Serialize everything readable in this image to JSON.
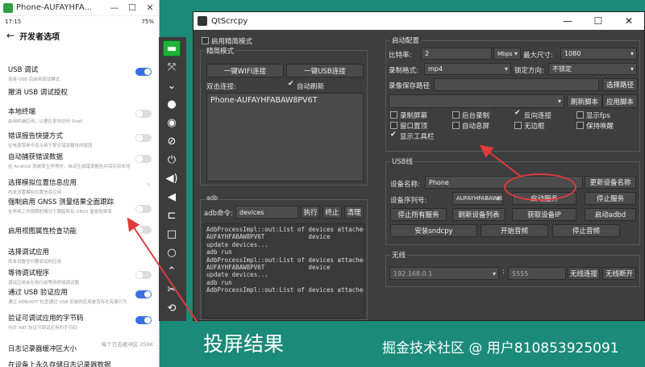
{
  "phone_window": {
    "title": "Phone-AUFAYHFA...",
    "status_time": "17:15",
    "status_right": "75%",
    "header": "开发者选项",
    "settings": [
      {
        "title": "USB 调试",
        "sub": "连接 USB 后启用调试模式",
        "control": "toggle-on"
      },
      {
        "title": "撤消 USB 调试授权",
        "sub": "",
        "control": "none"
      },
      {
        "title": "本地终端",
        "sub": "启用终端应用，以便在本地访问 Shell",
        "control": "toggle-off"
      },
      {
        "title": "错误报告快捷方式",
        "sub": "在电源菜单中显示用于提交错误报告的按钮",
        "control": "toggle-off"
      },
      {
        "title": "自动捕获错误数据",
        "sub": "在 Android 系统发生异常时，自动生成错误报告并保存到本地",
        "control": "toggle-off"
      },
      {
        "title": "选择模拟位置信息应用",
        "sub": "尚未设置模拟位置信息应用",
        "control": "chevron"
      },
      {
        "title": "强制启用 GNSS 测量结果全面跟踪",
        "sub": "在停用工作周期的情况下跟踪所有 GNSS 星座和频率",
        "control": "toggle-off"
      },
      {
        "title": "启用视图属性检查功能",
        "sub": "",
        "control": "toggle-off"
      },
      {
        "title": "选择调试应用",
        "sub": "尚未设置任何要调试的应用",
        "control": "none"
      },
      {
        "title": "等待调试程序",
        "sub": "调试应用会在执行前等待附加调试器",
        "control": "toggle-off"
      },
      {
        "title": "通过 USB 验证应用",
        "sub": "通过 ADB/ADT 检查通过 USB 安装的应用是否存在有害行为",
        "control": "toggle-on"
      },
      {
        "title": "验证可调试应用的字节码",
        "sub": "允许 ART 验证可调试应用的字节码",
        "control": "toggle-on"
      },
      {
        "title": "日志记录器缓冲区大小",
        "sub": "",
        "control": "value",
        "value": "每个日志缓冲区 256K"
      },
      {
        "title": "在设备上永久存储日志记录器数据",
        "sub": "",
        "control": "none"
      }
    ]
  },
  "toolbar": {
    "icons": [
      "screen-toggle-icon",
      "fullscreen-icon",
      "chevron-down-icon",
      "stop-icon",
      "eye-icon",
      "eye-slash-icon",
      "power-icon",
      "volume-up-icon",
      "volume-down-icon",
      "back-icon",
      "home-icon",
      "recent-apps-icon",
      "expand-icon",
      "shuffle-icon",
      "rotate-icon"
    ]
  },
  "qtscrcpy": {
    "title": "QtScrcpy",
    "left": {
      "enable_simple_mode": "启用精简模式",
      "simple_mode_group": "精简模式",
      "wifi_connect": "一键WIFI连接",
      "usb_connect": "一键USB连接",
      "double_click_connect": "双击连接:",
      "auto_refresh": "自动刷新",
      "device_list": [
        "Phone-AUFAYHFABAW8PV6T"
      ],
      "adb_group": "adb",
      "adb_cmd_label": "adb命令:",
      "adb_cmd_value": "devices",
      "execute": "执行",
      "terminate": "终止",
      "clear": "清理",
      "log_lines": [
        "AdbProcessImpl::out:List of devices attached",
        "AUFAYHFABAW8PV6T            device",
        "",
        "update devices...",
        "adb run",
        "AdbProcessImpl::out:List of devices attached",
        "AUFAYHFABAW8PV6T            device",
        "",
        "update devices...",
        "adb run",
        "AdbProcessImpl::out:List of devices attached"
      ]
    },
    "config": {
      "group": "启动配置",
      "bitrate_label": "比特率:",
      "bitrate_value": "2",
      "bitrate_unit": "Mbps",
      "max_size_label": "最大尺寸:",
      "max_size_value": "1080",
      "record_format_label": "录制格式:",
      "record_format_value": "mp4",
      "lock_orientation_label": "锁定方向:",
      "lock_orientation_value": "不锁定",
      "record_path_label": "录像保存路径",
      "select_path": "选择路径",
      "refresh_script": "刷新脚本",
      "apply_script": "应用脚本",
      "options": [
        {
          "label": "录制屏幕",
          "checked": false
        },
        {
          "label": "后台录制",
          "checked": false
        },
        {
          "label": "反向连接",
          "checked": true
        },
        {
          "label": "显示fps",
          "checked": false
        },
        {
          "label": "窗口置顶",
          "checked": false
        },
        {
          "label": "自动息屏",
          "checked": false
        },
        {
          "label": "无边框",
          "checked": false
        },
        {
          "label": "保持唤醒",
          "checked": false
        },
        {
          "label": "显示工具栏",
          "checked": true
        }
      ]
    },
    "usb": {
      "group": "USB线",
      "device_name_label": "设备名称:",
      "device_name_value": "Phone",
      "update_name": "更新设备名称",
      "serial_label": "设备序列号:",
      "serial_value": "AUFAYHFABAW8PV6",
      "start_service": "启动服务",
      "stop_service": "停止服务",
      "stop_all": "停止所有服务",
      "refresh_devices": "刷新设备列表",
      "get_ip": "获取设备IP",
      "start_adbd": "启动adbd",
      "install_sndcpy": "安装sndcpy",
      "start_audio": "开始音频",
      "stop_audio": "停止音频"
    },
    "wireless": {
      "group": "无线",
      "ip_value": "192.168.0.1",
      "port_value": "5555",
      "wireless_connect": "无线连接",
      "wireless_disconnect": "无线断开"
    }
  },
  "captions": {
    "left": "投屏结果",
    "right": "掘金技术社区 @ 用户810853925091"
  },
  "colors": {
    "background": "#1b8a78",
    "annotation": "#e23a3a",
    "toggle_on": "#3a6fe0"
  }
}
